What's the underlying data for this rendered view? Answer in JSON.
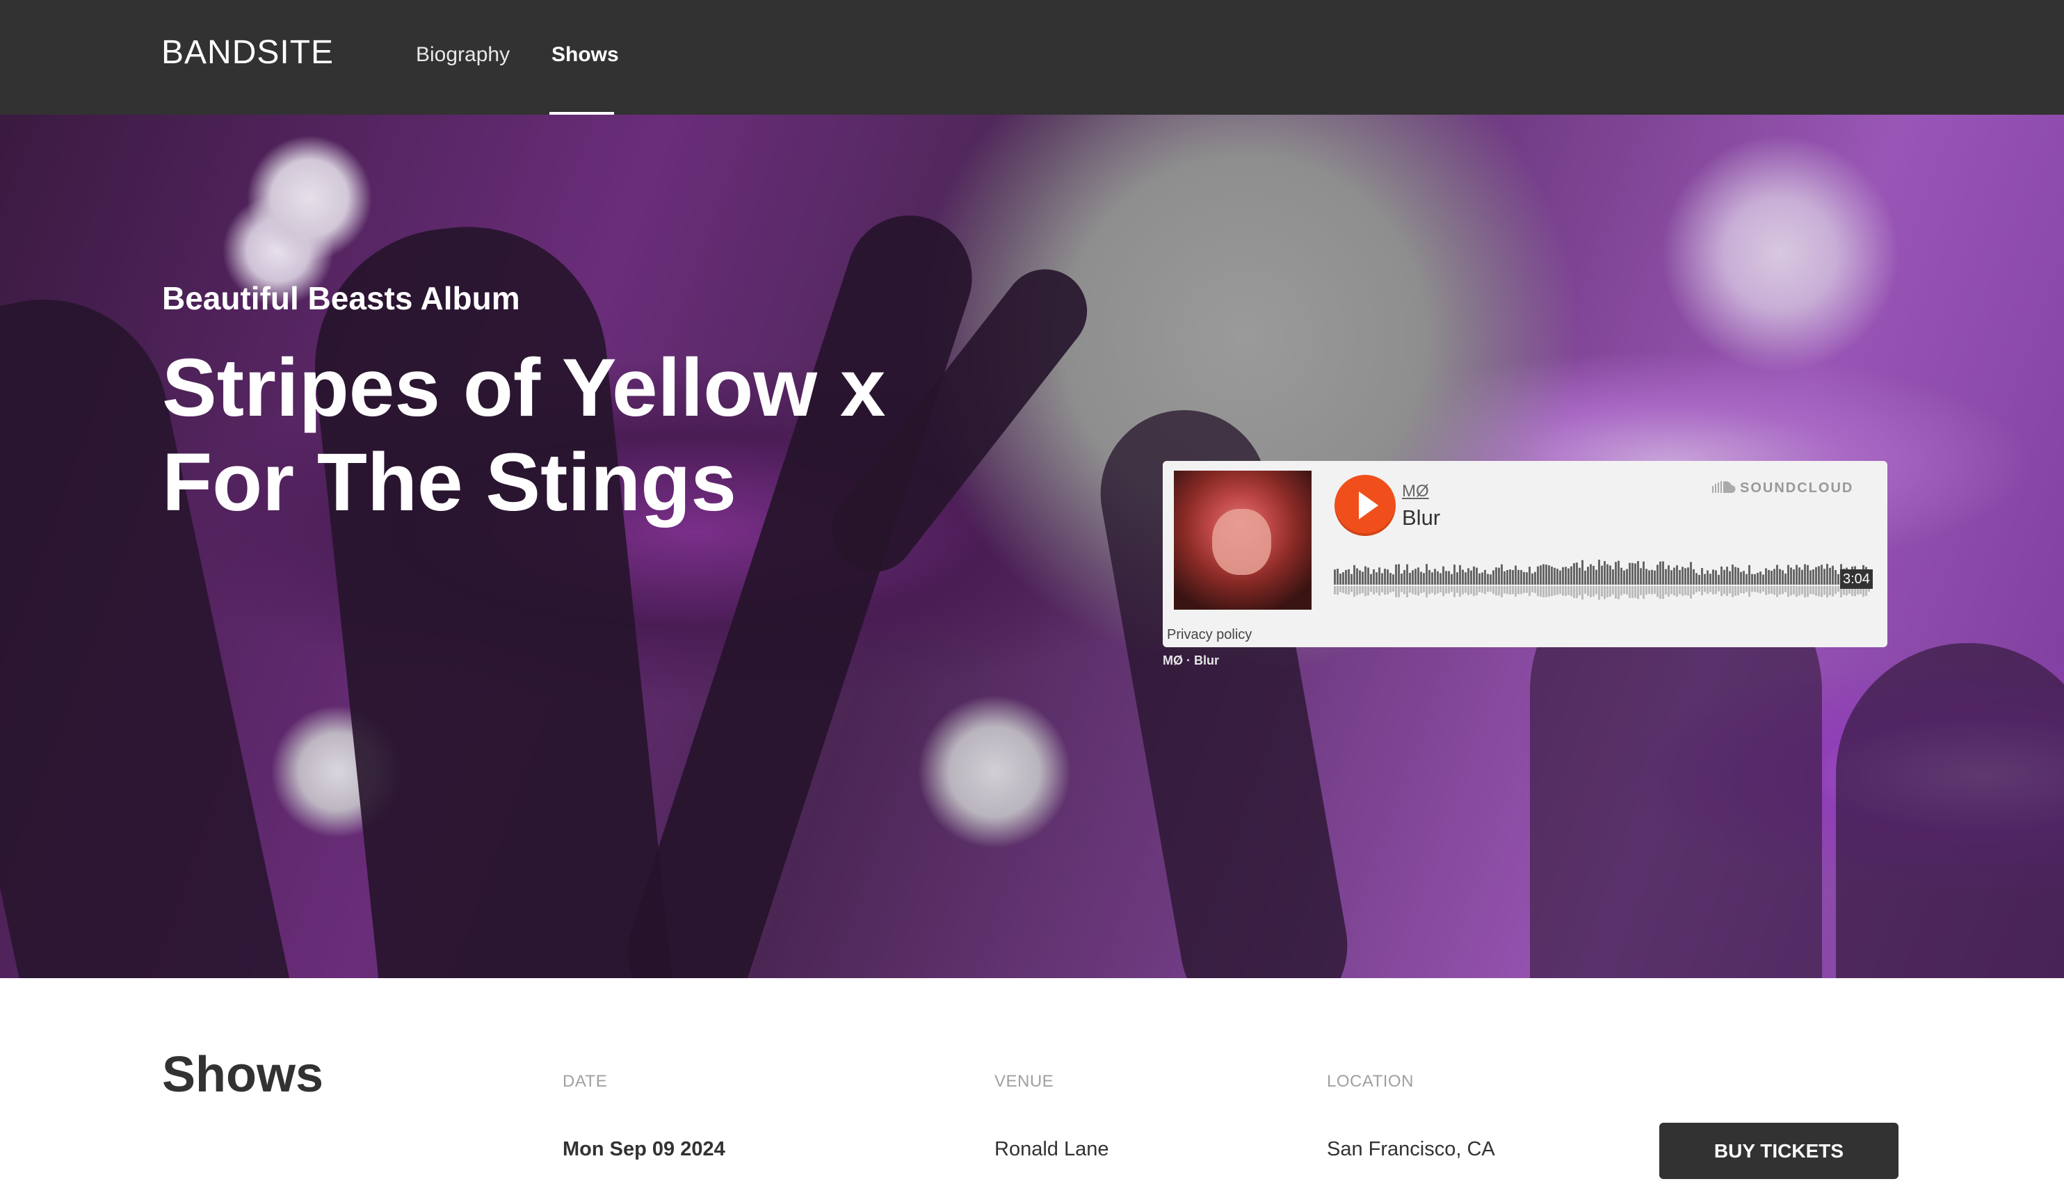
{
  "nav": {
    "logo": "BANDSITE",
    "links": [
      {
        "label": "Biography"
      },
      {
        "label": "Shows"
      }
    ]
  },
  "hero": {
    "subtitle": "Beautiful Beasts Album",
    "title": "Stripes of Yellow x For The Stings"
  },
  "soundcloud": {
    "artist": "MØ",
    "track": "Blur",
    "brand": "SOUNDCLOUD",
    "duration": "3:04",
    "privacy": "Privacy policy",
    "caption": "MØ · Blur"
  },
  "shows": {
    "title": "Shows",
    "columns": {
      "date": "DATE",
      "venue": "VENUE",
      "location": "LOCATION"
    },
    "rows": [
      {
        "date": "Mon Sep 09 2024",
        "venue": "Ronald Lane",
        "location": "San Francisco, CA",
        "button": "BUY TICKETS"
      }
    ]
  },
  "colors": {
    "nav_bg": "#323232",
    "soundcloud_orange": "#f04f1b",
    "hero_purple": "#8f3fb6"
  }
}
